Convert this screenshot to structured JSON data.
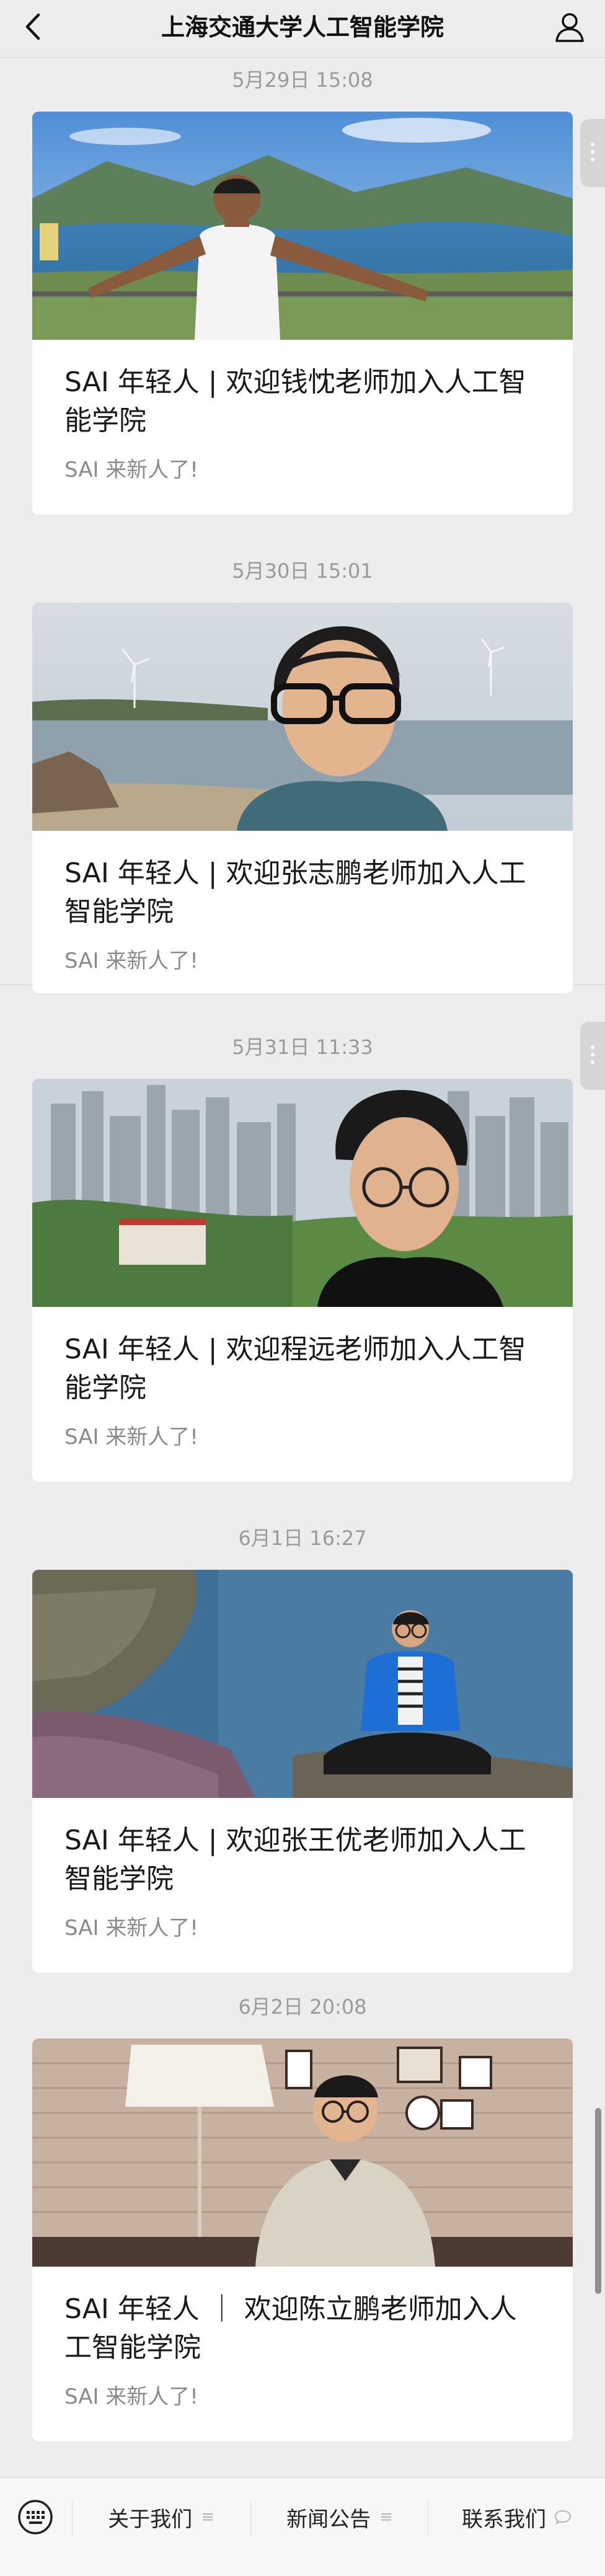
{
  "header": {
    "title": "上海交通大学人工智能学院",
    "back_icon": "chevron-left-icon",
    "profile_icon": "user-icon"
  },
  "feed": [
    {
      "time": "5月29日 15:08",
      "headline": "SAI 年轻人 | 欢迎钱忱老师加入人工智能学院",
      "summary": "SAI 来新人了!"
    },
    {
      "time": "5月30日 15:01",
      "headline": "SAI 年轻人 | 欢迎张志鹏老师加入人工智能学院",
      "summary": "SAI 来新人了!"
    },
    {
      "time": "5月31日 11:33",
      "headline": "SAI 年轻人 | 欢迎程远老师加入人工智能学院",
      "summary": "SAI 来新人了!"
    },
    {
      "time": "6月1日 16:27",
      "headline": "SAI 年轻人 | 欢迎张王优老师加入人工智能学院",
      "summary": "SAI 来新人了!"
    },
    {
      "time": "6月2日 20:08",
      "headline": "SAI 年轻人 ｜ 欢迎陈立鹏老师加入人工智能学院",
      "summary": "SAI 来新人了!"
    }
  ],
  "bottom_menu": {
    "keyboard_icon": "keyboard-icon",
    "items": [
      {
        "label": "关于我们",
        "icon": "menu-lines-icon"
      },
      {
        "label": "新闻公告",
        "icon": "menu-lines-icon"
      },
      {
        "label": "联系我们",
        "icon": "chat-bubble-icon"
      }
    ]
  }
}
